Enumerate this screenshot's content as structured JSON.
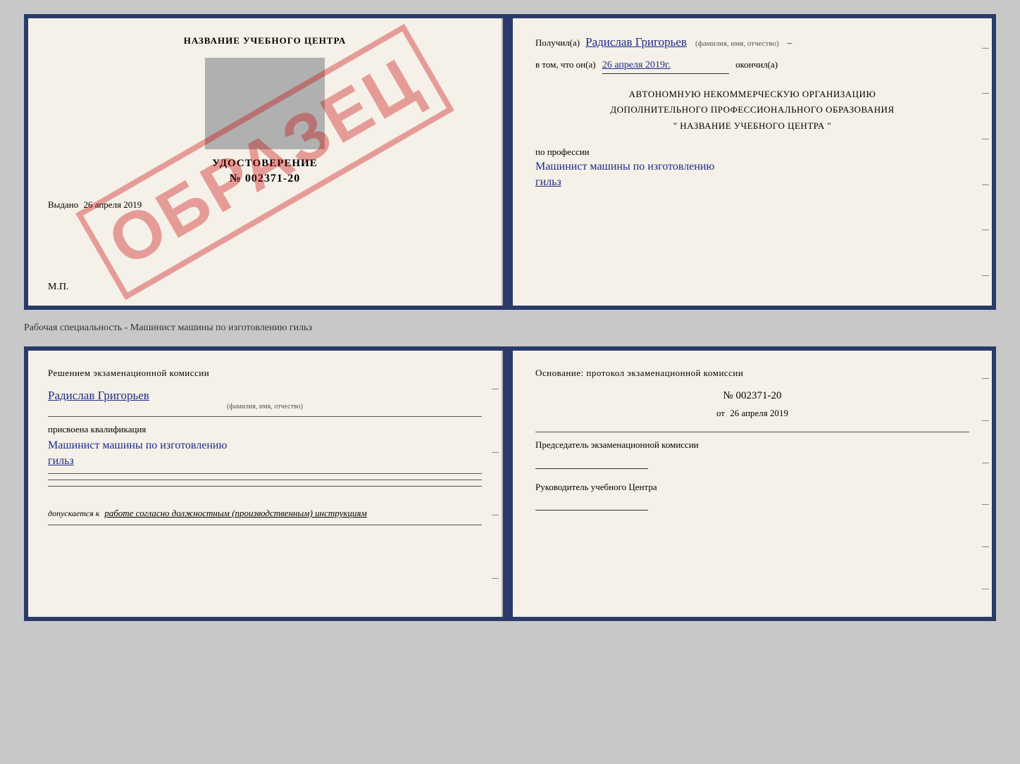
{
  "top_doc": {
    "left": {
      "header": "НАЗВАНИЕ УЧЕБНОГО ЦЕНТРА",
      "cert_title": "УДОСТОВЕРЕНИЕ",
      "cert_number": "№ 002371-20",
      "issued_label": "Выдано",
      "issued_date": "26 апреля 2019",
      "mp_label": "М.П.",
      "watermark": "ОБРАЗЕЦ"
    },
    "right": {
      "received_prefix": "Получил(а)",
      "recipient_name": "Радислав Григорьев",
      "name_hint": "(фамилия, имя, отчество)",
      "date_prefix": "в том, что он(а)",
      "date_value": "26 апреля 2019г.",
      "date_suffix": "окончил(а)",
      "org_line1": "АВТОНОМНУЮ НЕКОММЕРЧЕСКУЮ ОРГАНИЗАЦИЮ",
      "org_line2": "ДОПОЛНИТЕЛЬНОГО ПРОФЕССИОНАЛЬНОГО ОБРАЗОВАНИЯ",
      "org_line3": "\" НАЗВАНИЕ УЧЕБНОГО ЦЕНТРА \"",
      "profession_label": "по профессии",
      "profession_value": "Машинист машины по изготовлению",
      "profession_value2": "гильз"
    }
  },
  "separator": "Рабочая специальность - Машинист машины по изготовлению гильз",
  "bottom_doc": {
    "left": {
      "commission_title": "Решением  экзаменационной  комиссии",
      "person_name": "Радислав Григорьев",
      "name_hint": "(фамилия, имя, отчество)",
      "qualified_label": "присвоена квалификация",
      "qualification": "Машинист  машины  по изготовлению",
      "qualification2": "гильз",
      "admit_prefix": "допускается к",
      "admit_text": "работе согласно должностным (производственным) инструкциям"
    },
    "right": {
      "basis_title": "Основание:  протокол экзаменационной  комиссии",
      "protocol_number": "№  002371-20",
      "date_prefix": "от",
      "date_value": "26 апреля 2019",
      "chairman_label": "Председатель экзаменационной комиссии",
      "director_label": "Руководитель учебного Центра"
    }
  }
}
